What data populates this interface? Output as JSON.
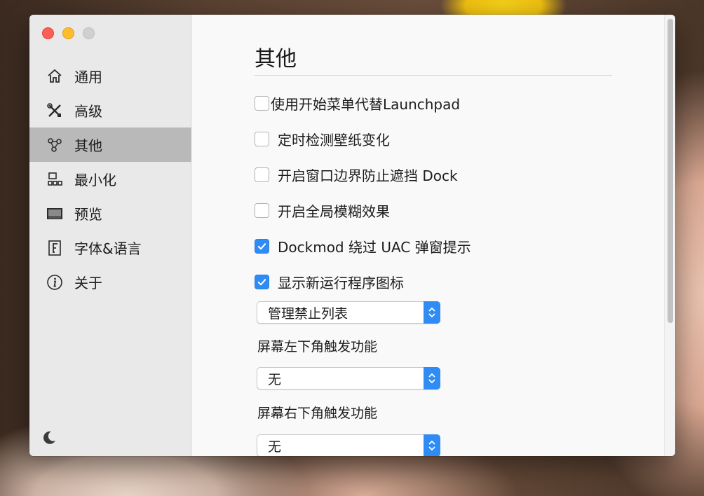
{
  "window": {
    "title": "其他"
  },
  "sidebar": {
    "items": [
      {
        "label": "通用",
        "icon": "house-icon",
        "active": false
      },
      {
        "label": "高级",
        "icon": "tools-icon",
        "active": false
      },
      {
        "label": "其他",
        "icon": "network-nodes-icon",
        "active": true
      },
      {
        "label": "最小化",
        "icon": "minimize-icon",
        "active": false
      },
      {
        "label": "预览",
        "icon": "preview-icon",
        "active": false
      },
      {
        "label": "字体&语言",
        "icon": "font-icon",
        "active": false
      },
      {
        "label": "关于",
        "icon": "info-icon",
        "active": false
      }
    ],
    "bottom_icon": "moon-icon"
  },
  "content": {
    "checkboxes": [
      {
        "label": "使用开始菜单代替Launchpad",
        "checked": false
      },
      {
        "label": "定时检测壁纸变化",
        "checked": false
      },
      {
        "label": "开启窗口边界防止遮挡 Dock",
        "checked": false
      },
      {
        "label": "开启全局模糊效果",
        "checked": false
      },
      {
        "label": "Dockmod 绕过 UAC 弹窗提示",
        "checked": true
      },
      {
        "label": "显示新运行程序图标",
        "checked": true
      }
    ],
    "blacklist_select": {
      "value": "管理禁止列表"
    },
    "bottom_left": {
      "label": "屏幕左下角触发功能",
      "value": "无"
    },
    "bottom_right": {
      "label": "屏幕右下角触发功能",
      "value": "无"
    }
  },
  "colors": {
    "accent": "#2f8cf5",
    "sidebar_active": "#b9b9b9",
    "close": "#fd5f57",
    "minimize": "#febc2e",
    "zoom_disabled": "#d0d0d0"
  }
}
